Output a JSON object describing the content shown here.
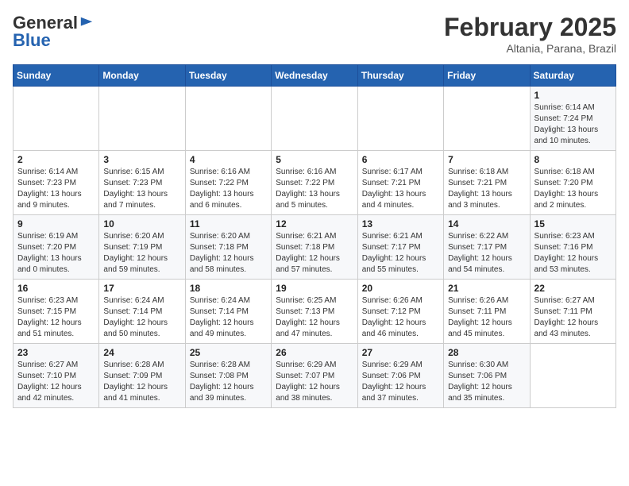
{
  "header": {
    "logo_general": "General",
    "logo_blue": "Blue",
    "title": "February 2025",
    "subtitle": "Altania, Parana, Brazil"
  },
  "days_of_week": [
    "Sunday",
    "Monday",
    "Tuesday",
    "Wednesday",
    "Thursday",
    "Friday",
    "Saturday"
  ],
  "weeks": [
    [
      {
        "day": "",
        "info": ""
      },
      {
        "day": "",
        "info": ""
      },
      {
        "day": "",
        "info": ""
      },
      {
        "day": "",
        "info": ""
      },
      {
        "day": "",
        "info": ""
      },
      {
        "day": "",
        "info": ""
      },
      {
        "day": "1",
        "info": "Sunrise: 6:14 AM\nSunset: 7:24 PM\nDaylight: 13 hours and 10 minutes."
      }
    ],
    [
      {
        "day": "2",
        "info": "Sunrise: 6:14 AM\nSunset: 7:23 PM\nDaylight: 13 hours and 9 minutes."
      },
      {
        "day": "3",
        "info": "Sunrise: 6:15 AM\nSunset: 7:23 PM\nDaylight: 13 hours and 7 minutes."
      },
      {
        "day": "4",
        "info": "Sunrise: 6:16 AM\nSunset: 7:22 PM\nDaylight: 13 hours and 6 minutes."
      },
      {
        "day": "5",
        "info": "Sunrise: 6:16 AM\nSunset: 7:22 PM\nDaylight: 13 hours and 5 minutes."
      },
      {
        "day": "6",
        "info": "Sunrise: 6:17 AM\nSunset: 7:21 PM\nDaylight: 13 hours and 4 minutes."
      },
      {
        "day": "7",
        "info": "Sunrise: 6:18 AM\nSunset: 7:21 PM\nDaylight: 13 hours and 3 minutes."
      },
      {
        "day": "8",
        "info": "Sunrise: 6:18 AM\nSunset: 7:20 PM\nDaylight: 13 hours and 2 minutes."
      }
    ],
    [
      {
        "day": "9",
        "info": "Sunrise: 6:19 AM\nSunset: 7:20 PM\nDaylight: 13 hours and 0 minutes."
      },
      {
        "day": "10",
        "info": "Sunrise: 6:20 AM\nSunset: 7:19 PM\nDaylight: 12 hours and 59 minutes."
      },
      {
        "day": "11",
        "info": "Sunrise: 6:20 AM\nSunset: 7:18 PM\nDaylight: 12 hours and 58 minutes."
      },
      {
        "day": "12",
        "info": "Sunrise: 6:21 AM\nSunset: 7:18 PM\nDaylight: 12 hours and 57 minutes."
      },
      {
        "day": "13",
        "info": "Sunrise: 6:21 AM\nSunset: 7:17 PM\nDaylight: 12 hours and 55 minutes."
      },
      {
        "day": "14",
        "info": "Sunrise: 6:22 AM\nSunset: 7:17 PM\nDaylight: 12 hours and 54 minutes."
      },
      {
        "day": "15",
        "info": "Sunrise: 6:23 AM\nSunset: 7:16 PM\nDaylight: 12 hours and 53 minutes."
      }
    ],
    [
      {
        "day": "16",
        "info": "Sunrise: 6:23 AM\nSunset: 7:15 PM\nDaylight: 12 hours and 51 minutes."
      },
      {
        "day": "17",
        "info": "Sunrise: 6:24 AM\nSunset: 7:14 PM\nDaylight: 12 hours and 50 minutes."
      },
      {
        "day": "18",
        "info": "Sunrise: 6:24 AM\nSunset: 7:14 PM\nDaylight: 12 hours and 49 minutes."
      },
      {
        "day": "19",
        "info": "Sunrise: 6:25 AM\nSunset: 7:13 PM\nDaylight: 12 hours and 47 minutes."
      },
      {
        "day": "20",
        "info": "Sunrise: 6:26 AM\nSunset: 7:12 PM\nDaylight: 12 hours and 46 minutes."
      },
      {
        "day": "21",
        "info": "Sunrise: 6:26 AM\nSunset: 7:11 PM\nDaylight: 12 hours and 45 minutes."
      },
      {
        "day": "22",
        "info": "Sunrise: 6:27 AM\nSunset: 7:11 PM\nDaylight: 12 hours and 43 minutes."
      }
    ],
    [
      {
        "day": "23",
        "info": "Sunrise: 6:27 AM\nSunset: 7:10 PM\nDaylight: 12 hours and 42 minutes."
      },
      {
        "day": "24",
        "info": "Sunrise: 6:28 AM\nSunset: 7:09 PM\nDaylight: 12 hours and 41 minutes."
      },
      {
        "day": "25",
        "info": "Sunrise: 6:28 AM\nSunset: 7:08 PM\nDaylight: 12 hours and 39 minutes."
      },
      {
        "day": "26",
        "info": "Sunrise: 6:29 AM\nSunset: 7:07 PM\nDaylight: 12 hours and 38 minutes."
      },
      {
        "day": "27",
        "info": "Sunrise: 6:29 AM\nSunset: 7:06 PM\nDaylight: 12 hours and 37 minutes."
      },
      {
        "day": "28",
        "info": "Sunrise: 6:30 AM\nSunset: 7:06 PM\nDaylight: 12 hours and 35 minutes."
      },
      {
        "day": "",
        "info": ""
      }
    ]
  ]
}
